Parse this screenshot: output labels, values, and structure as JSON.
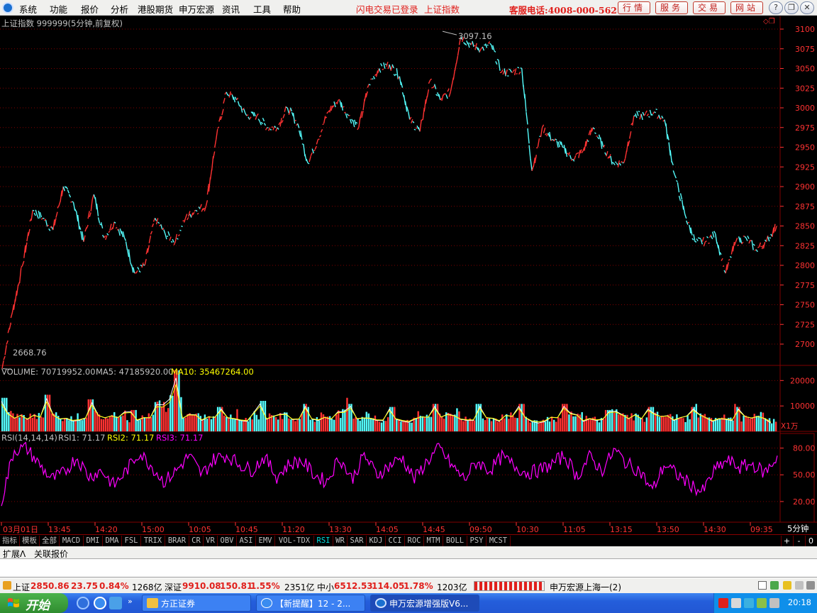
{
  "menubar": {
    "items": [
      "系统",
      "功能",
      "报价",
      "分析",
      "港股期货",
      "申万宏源",
      "资讯",
      "工具",
      "帮助"
    ],
    "notice_login": "闪电交易已登录",
    "notice_index": "上证指数",
    "hotline": "客服电话:4008-000-562",
    "buttons": [
      "行情",
      "服务",
      "交易",
      "网站"
    ],
    "window_controls": [
      "question-icon",
      "restore-icon",
      "close-icon"
    ]
  },
  "chart_header": {
    "title": "上证指数 999999(5分钟,前复权)",
    "high_label": "3097.16",
    "low_label": "2668.76"
  },
  "volume_header": {
    "label": "VOLUME: 70719952.00",
    "ma5": "MA5: 47185920.00",
    "ma10": "MA10: 35467264.00",
    "unit": "X1万"
  },
  "rsi_header": {
    "label": "RSI(14,14,14)",
    "rsi1": "RSI1: 71.17",
    "rsi2": "RSI2: 71.17",
    "rsi3": "RSI3: 71.17"
  },
  "chart_data": [
    {
      "type": "line",
      "title": "上证指数 999999(5分钟,前复权)",
      "note": "5-minute candlestick price series, approximated as closing-price line",
      "ylim": [
        2668.76,
        3110
      ],
      "y_ticks": [
        3100,
        3075,
        3050,
        3025,
        3000,
        2975,
        2950,
        2925,
        2900,
        2875,
        2850,
        2825,
        2800,
        2775,
        2750,
        2725,
        2700
      ],
      "series": [
        {
          "values": [
            2669,
            2740,
            2800,
            2870,
            2860,
            2845,
            2900,
            2880,
            2830,
            2890,
            2835,
            2855,
            2835,
            2790,
            2800,
            2860,
            2840,
            2830,
            2860,
            2870,
            2875,
            2960,
            3020,
            3010,
            2990,
            2990,
            2975,
            2975,
            3000,
            2980,
            2930,
            2960,
            2995,
            3010,
            2990,
            2975,
            3030,
            3050,
            3055,
            3040,
            2985,
            2970,
            3035,
            3010,
            3020,
            3090,
            3080,
            3075,
            3080,
            3045,
            3045,
            3050,
            2920,
            2975,
            2960,
            2950,
            2935,
            2945,
            2975,
            2950,
            2930,
            2930,
            2990,
            2990,
            2995,
            2985,
            2915,
            2865,
            2830,
            2830,
            2840,
            2790,
            2830,
            2835,
            2820,
            2830,
            2850
          ]
        }
      ]
    },
    {
      "type": "bar",
      "title": "VOLUME",
      "y_ticks": [
        20000,
        10000
      ],
      "series": [
        {
          "name": "VOLUME",
          "values": [
            11000,
            9000,
            10000,
            12000,
            8000,
            9000,
            10500,
            9000,
            12000,
            7000,
            9000,
            16000,
            20000,
            10000,
            9000,
            8000,
            11000,
            8000,
            10000,
            9000,
            10000,
            9000,
            8000,
            10000,
            11000,
            9000,
            10000,
            7000,
            8000,
            7000,
            10000,
            9000,
            12000,
            8000,
            9000,
            8000,
            10000,
            9000,
            7000,
            8000,
            9000,
            10000,
            8000,
            7000,
            12000,
            9000,
            8000,
            10000,
            9000,
            8000,
            9000,
            7000,
            9000,
            8000,
            11000,
            7000
          ]
        },
        {
          "name": "MA5",
          "values": []
        },
        {
          "name": "MA10",
          "values": []
        }
      ]
    },
    {
      "type": "line",
      "title": "RSI(14,14,14)",
      "y_ticks": [
        80.0,
        50.0,
        20.0
      ],
      "series": [
        {
          "name": "RSI1",
          "values": [
            20,
            78,
            80,
            62,
            45,
            52,
            70,
            48,
            55,
            38,
            55,
            75,
            60,
            42,
            55,
            72,
            50,
            68,
            72,
            62,
            55,
            70,
            48,
            62,
            66,
            50,
            42,
            70,
            45,
            72,
            50,
            60,
            70,
            45,
            65,
            80,
            60,
            45,
            65,
            55,
            70,
            60,
            52,
            55,
            62,
            72,
            48,
            70,
            55,
            78,
            62,
            55,
            32,
            62,
            50,
            40,
            30,
            55,
            66,
            58,
            62,
            52,
            70
          ]
        }
      ]
    }
  ],
  "x_axis": {
    "labels": [
      "03月01日",
      "13:45",
      "14:20",
      "15:00",
      "10:05",
      "10:45",
      "11:20",
      "13:30",
      "14:05",
      "14:45",
      "09:50",
      "10:30",
      "11:05",
      "13:15",
      "13:50",
      "14:30",
      "09:35"
    ],
    "period": "5分钟"
  },
  "indicator_tabs": [
    "指标",
    "模板",
    "全部",
    "MACD",
    "DMI",
    "DMA",
    "FSL",
    "TRIX",
    "BRAR",
    "CR",
    "VR",
    "OBV",
    "ASI",
    "EMV",
    "VOL-TDX",
    "RSI",
    "WR",
    "SAR",
    "KDJ",
    "CCI",
    "ROC",
    "MTM",
    "BOLL",
    "PSY",
    "MCST"
  ],
  "active_indicator": "RSI",
  "indicator_controls": [
    "+",
    "-",
    "0"
  ],
  "ext_tabs": [
    "扩展Λ",
    "关联报价"
  ],
  "statusbar": {
    "sh_label": "上证",
    "sh_value": "2850.86",
    "sh_change": "23.75",
    "sh_pct": "0.84%",
    "sh_amount": "1268亿",
    "sz_label": "深证",
    "sz_value": "9910.08",
    "sz_change": "150.81",
    "sz_pct": "1.55%",
    "sz_amount": "2351亿",
    "zx_label": "中小",
    "zx_value": "6512.53",
    "zx_change": "114.05",
    "zx_pct": "1.78%",
    "zx_amount": "1203亿",
    "server": "申万宏源上海一(2)"
  },
  "taskbar": {
    "start": "开始",
    "tasks": [
      "方正证券",
      "【新提醒】12 - 2...",
      "申万宏源增强版V6..."
    ],
    "clock": "20:18"
  },
  "colors": {
    "up": "#ff3232",
    "down": "#54fcfc",
    "rsi": "#ff00ff",
    "grid": "#800000",
    "axis_text": "#ff3232"
  }
}
